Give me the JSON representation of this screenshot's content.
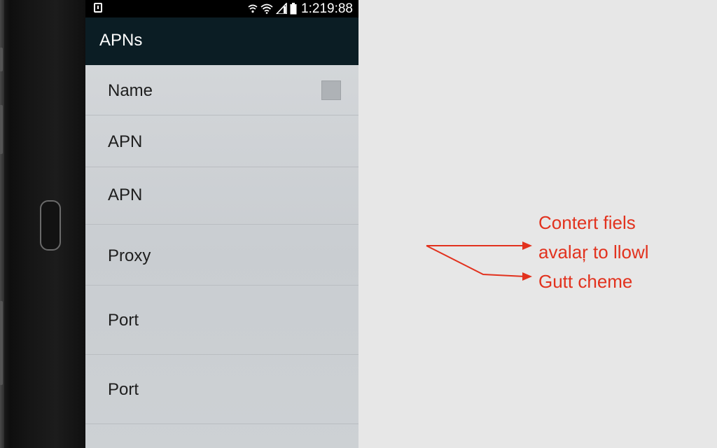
{
  "status_bar": {
    "time": "1:219:88",
    "icons": [
      "notification-icon",
      "nfc-icon",
      "wifi-icon",
      "signal-icon",
      "battery-icon"
    ]
  },
  "app_bar": {
    "title": "APNs"
  },
  "list": {
    "items": [
      {
        "label": "Name",
        "has_checkbox": true
      },
      {
        "label": "APN"
      },
      {
        "label": "APN"
      },
      {
        "label": "Proxy"
      },
      {
        "label": "Port"
      },
      {
        "label": "Port"
      },
      {
        "label": ""
      }
    ]
  },
  "annotation": {
    "lines": [
      "Contert fiels",
      "avalaŗ to llowl",
      "Gutt cheme"
    ],
    "color": "#e2321e"
  },
  "colors": {
    "app_bar": "#0b1d24",
    "list_background": "#cfd3d7",
    "status_bar": "#000000",
    "page_background": "#e7e7e7"
  }
}
